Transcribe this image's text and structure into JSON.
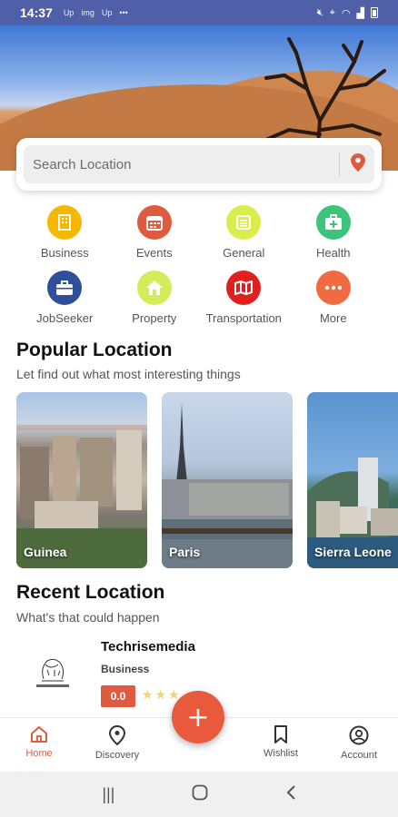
{
  "status": {
    "time": "14:37",
    "indicators": [
      "Up",
      "img",
      "Up",
      "•••"
    ]
  },
  "search": {
    "placeholder": "Search Location",
    "icon": "location-pin-icon"
  },
  "categories": [
    {
      "label": "Business",
      "color": "#f5b800",
      "icon": "building-icon"
    },
    {
      "label": "Events",
      "color": "#e05a3f",
      "icon": "calendar-icon"
    },
    {
      "label": "General",
      "color": "#d9ee4a",
      "icon": "list-icon"
    },
    {
      "label": "Health",
      "color": "#3cc47a",
      "icon": "medkit-icon"
    },
    {
      "label": "JobSeeker",
      "color": "#2f4f9a",
      "icon": "briefcase-icon"
    },
    {
      "label": "Property",
      "color": "#d4ec5a",
      "icon": "home-icon"
    },
    {
      "label": "Transportation",
      "color": "#e01f1f",
      "icon": "map-icon"
    },
    {
      "label": "More",
      "color": "#f26a3f",
      "icon": "more-icon"
    }
  ],
  "popular": {
    "title": "Popular Location",
    "subtitle": "Let find out what most interesting things",
    "locations": [
      {
        "name": "Guinea"
      },
      {
        "name": "Paris"
      },
      {
        "name": "Sierra Leone"
      }
    ]
  },
  "recent": {
    "title": "Recent Location",
    "subtitle": "What's that could happen",
    "item": {
      "name": "Techrisemedia",
      "category": "Business",
      "rating": "0.0",
      "stars": "★★★"
    }
  },
  "nav": {
    "home": "Home",
    "discovery": "Discovery",
    "wishlist": "Wishlist",
    "account": "Account",
    "fab": "+"
  },
  "colors": {
    "accent": "#e05a3f",
    "status_bar": "#4f5fa8"
  }
}
